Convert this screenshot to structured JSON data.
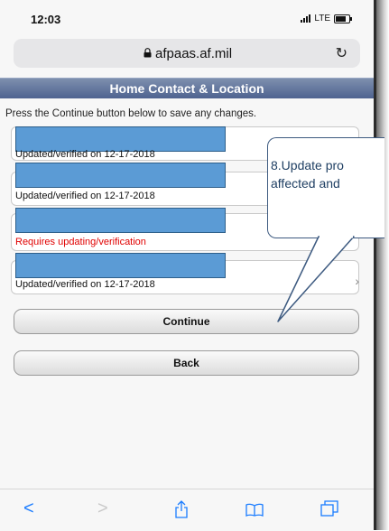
{
  "status_bar": {
    "time": "12:03",
    "network": "LTE"
  },
  "browser": {
    "url": "afpaas.af.mil"
  },
  "page": {
    "title": "Home Contact & Location",
    "instructions": "Press the Continue button below to save any changes."
  },
  "items": [
    {
      "status": "Updated/verified on 12-17-2018",
      "status_color": "#111111"
    },
    {
      "status": "Updated/verified on 12-17-2018",
      "status_color": "#111111"
    },
    {
      "status": "Requires updating/verification",
      "status_color": "#e00000"
    },
    {
      "status": "Updated/verified on 12-17-2018",
      "status_color": "#111111"
    }
  ],
  "buttons": {
    "continue": "Continue",
    "back": "Back"
  },
  "callout": {
    "line1": "8.Update pro",
    "line2": "affected and"
  },
  "colors": {
    "header": "#4f6390",
    "redaction": "#5b9bd5",
    "callout_border": "#3d5a80",
    "link_blue": "#1a7cff"
  },
  "toolbar": {
    "icons": [
      "back-icon",
      "forward-icon",
      "share-icon",
      "bookmarks-icon",
      "tabs-icon"
    ]
  }
}
